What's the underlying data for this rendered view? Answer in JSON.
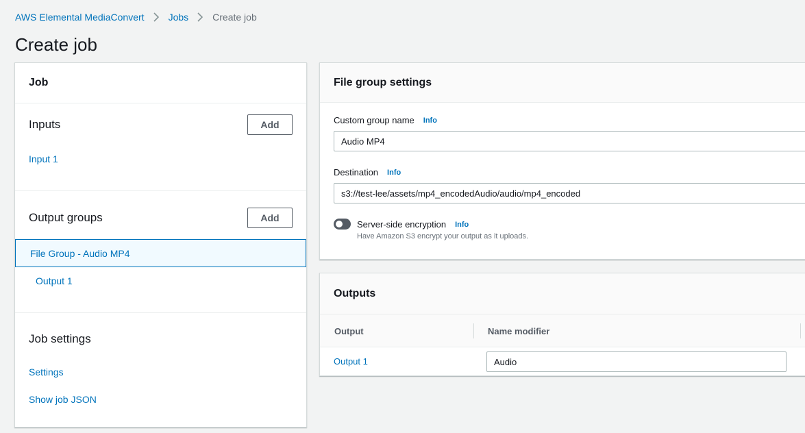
{
  "breadcrumb": {
    "items": [
      "AWS Elemental MediaConvert",
      "Jobs"
    ],
    "current": "Create job"
  },
  "page": {
    "title": "Create job"
  },
  "job_panel": {
    "header": "Job",
    "inputs": {
      "title": "Inputs",
      "add_label": "Add",
      "items": [
        "Input 1"
      ]
    },
    "output_groups": {
      "title": "Output groups",
      "add_label": "Add",
      "selected_group": "File Group - Audio MP4",
      "outputs": [
        "Output 1"
      ]
    },
    "job_settings": {
      "title": "Job settings",
      "links": [
        "Settings",
        "Show job JSON"
      ]
    }
  },
  "file_group_settings": {
    "header": "File group settings",
    "custom_group_name": {
      "label": "Custom group name",
      "info": "Info",
      "value": "Audio MP4"
    },
    "destination": {
      "label": "Destination",
      "info": "Info",
      "value": "s3://test-lee/assets/mp4_encodedAudio/audio/mp4_encoded"
    },
    "encryption": {
      "label": "Server-side encryption",
      "info": "Info",
      "description": "Have Amazon S3 encrypt your output as it uploads.",
      "enabled": false
    }
  },
  "outputs_panel": {
    "header": "Outputs",
    "columns": [
      "Output",
      "Name modifier"
    ],
    "rows": [
      {
        "output": "Output 1",
        "name_modifier": "Audio"
      }
    ]
  },
  "colors": {
    "link": "#0073bb",
    "background": "#f2f3f3",
    "selected_bg": "#f1faff"
  }
}
